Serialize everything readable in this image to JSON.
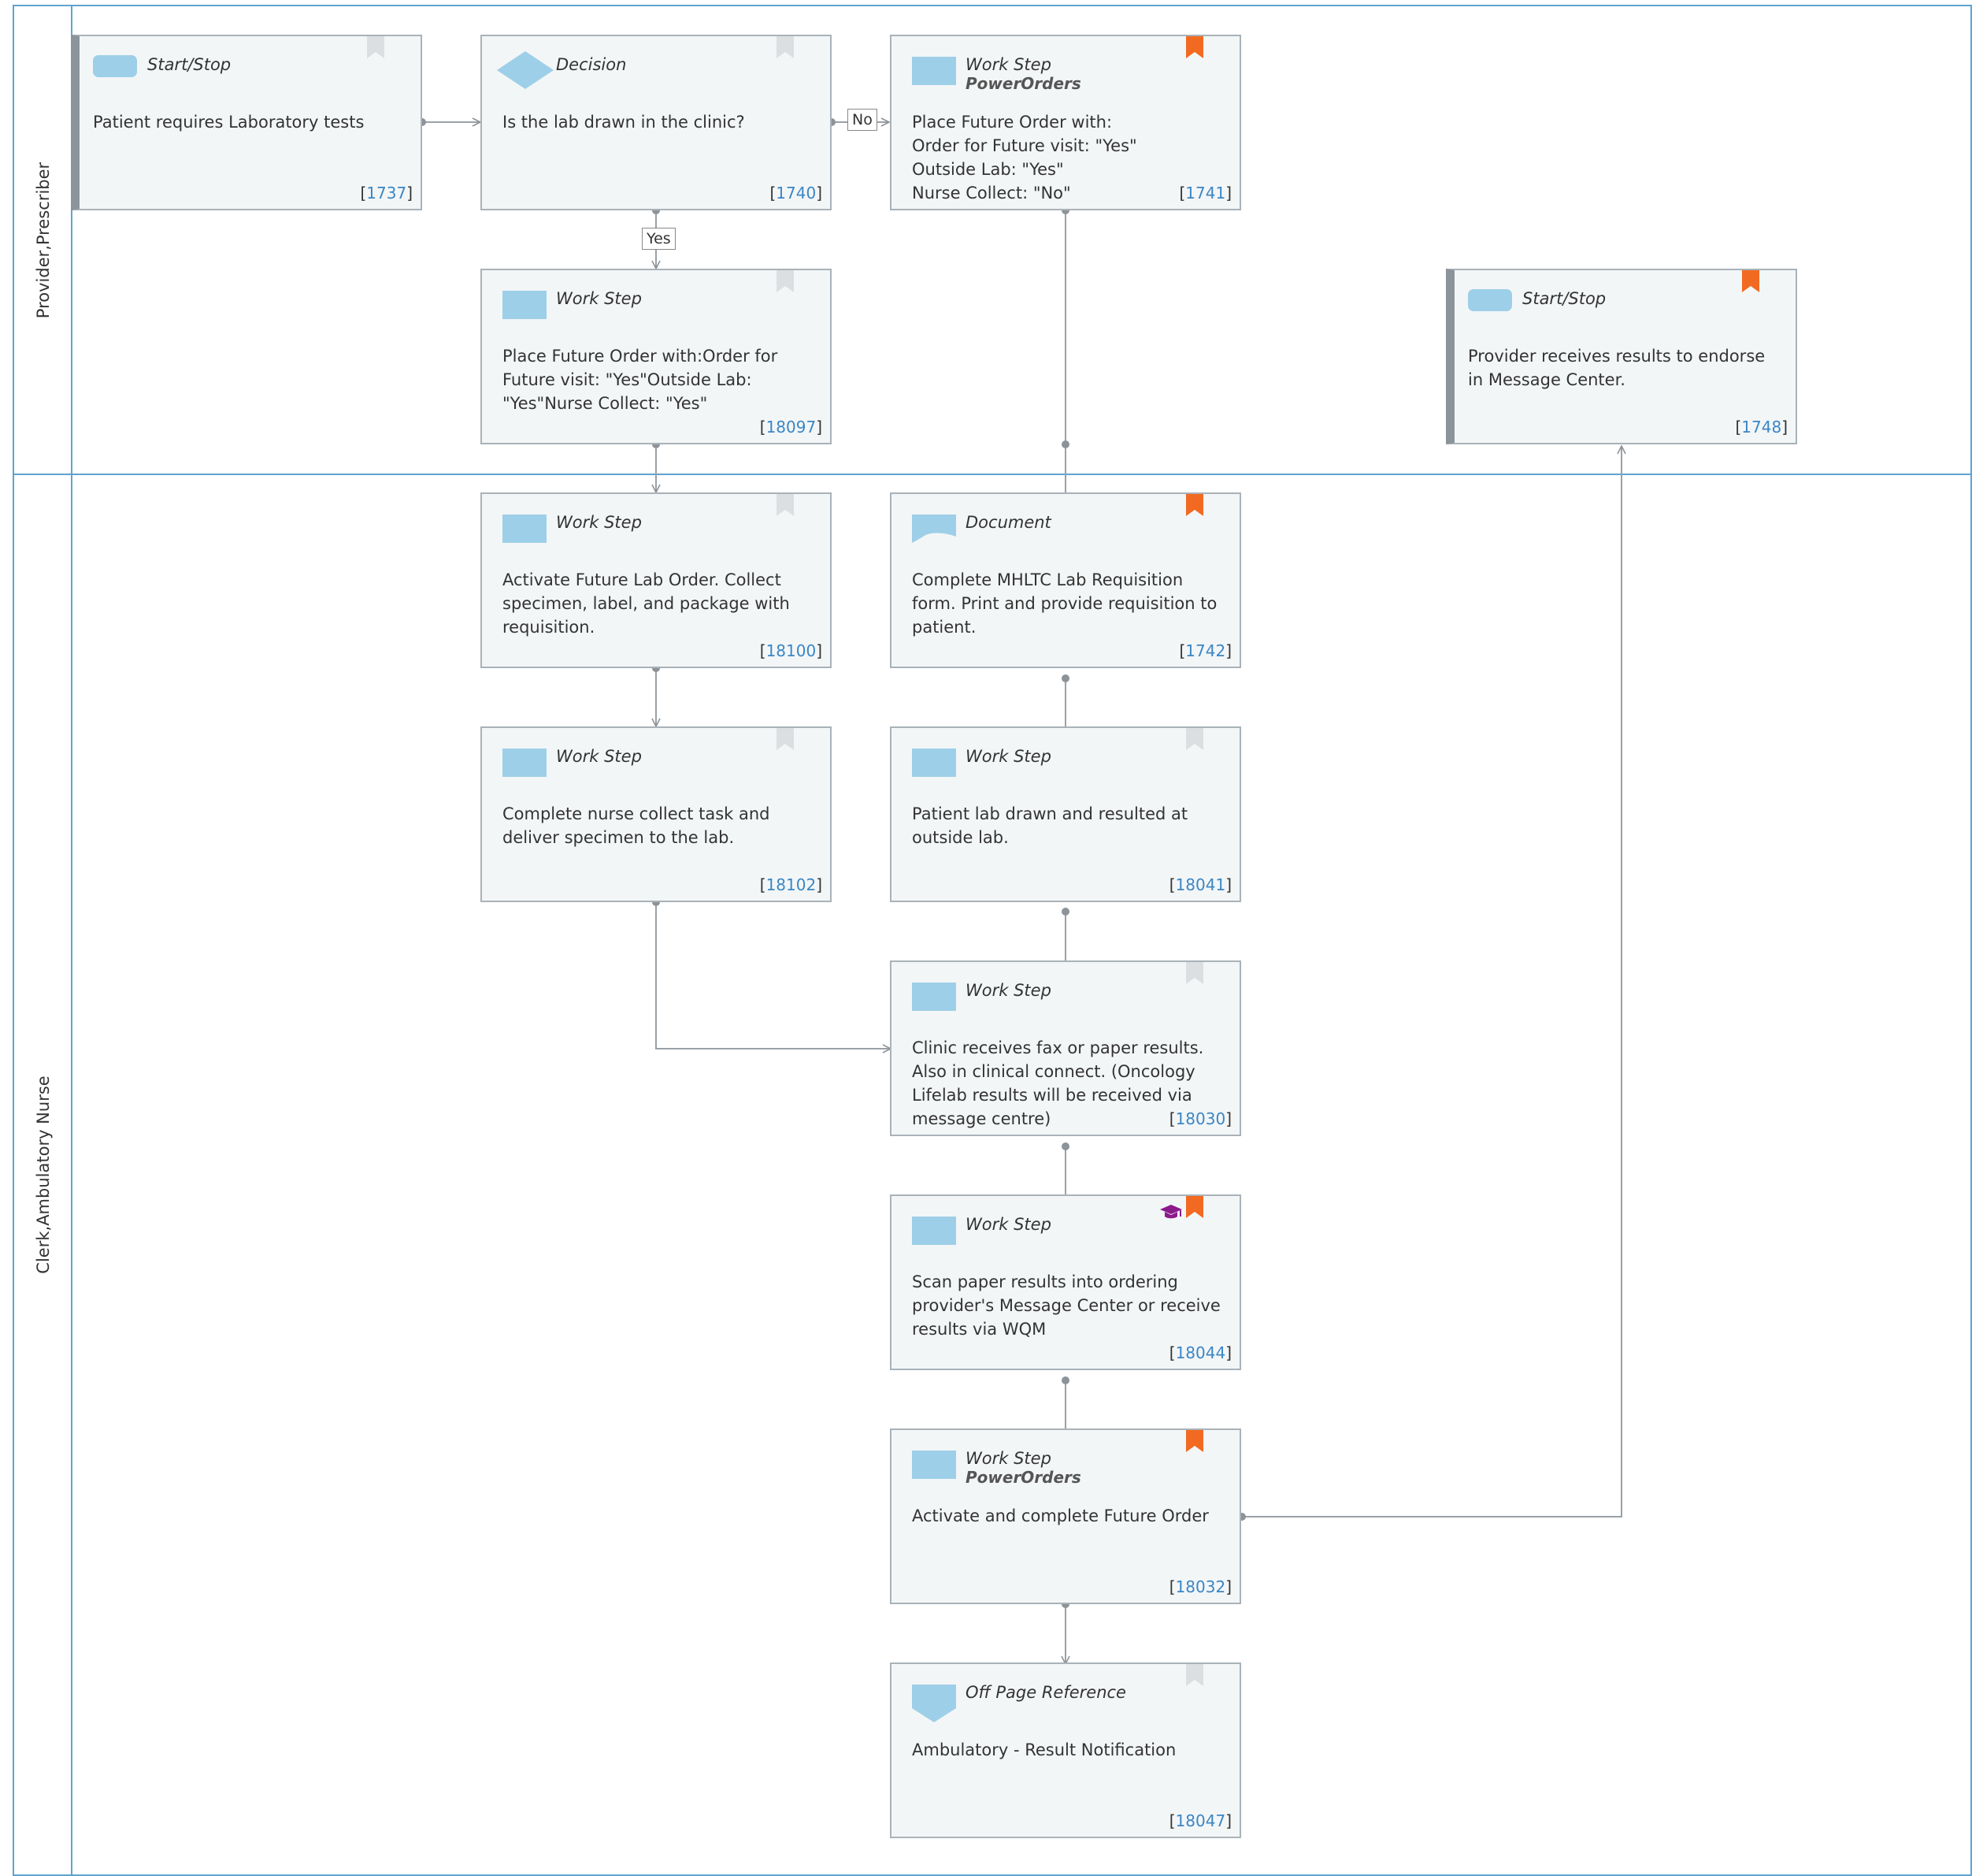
{
  "lanes": [
    {
      "name": "Provider,Prescriber"
    },
    {
      "name": "Clerk,Ambulatory Nurse"
    }
  ],
  "nodes": [
    {
      "key": "n1737",
      "type": "Start/Stop",
      "subtype": "",
      "body": "Patient requires Laboratory tests",
      "id": "1737",
      "bookmark": "grey"
    },
    {
      "key": "n1740",
      "type": "Decision",
      "subtype": "",
      "body": "Is the lab drawn in the clinic?",
      "id": "1740",
      "bookmark": "grey"
    },
    {
      "key": "n1741",
      "type": "Work Step",
      "subtype": "PowerOrders",
      "body": "Place Future Order with:\nOrder for Future visit: \"Yes\"\nOutside Lab: \"Yes\"\nNurse Collect: \"No\"",
      "id": "1741",
      "bookmark": "orange"
    },
    {
      "key": "n18097",
      "type": "Work Step",
      "subtype": "",
      "body": "Place Future Order with:Order for Future visit: \"Yes\"Outside Lab: \"Yes\"Nurse Collect: \"Yes\"",
      "id": "18097",
      "bookmark": "grey"
    },
    {
      "key": "n1748",
      "type": "Start/Stop",
      "subtype": "",
      "body": "Provider receives results to endorse in Message Center.",
      "id": "1748",
      "bookmark": "orange"
    },
    {
      "key": "n18100",
      "type": "Work Step",
      "subtype": "",
      "body": "Activate Future Lab Order. Collect specimen, label, and package with requisition.",
      "id": "18100",
      "bookmark": "grey"
    },
    {
      "key": "n1742",
      "type": "Document",
      "subtype": "",
      "body": "Complete MHLTC Lab Requisition form. Print and provide requisition to patient.",
      "id": "1742",
      "bookmark": "orange"
    },
    {
      "key": "n18102",
      "type": "Work Step",
      "subtype": "",
      "body": "Complete nurse collect task and deliver specimen to the lab.",
      "id": "18102",
      "bookmark": "grey"
    },
    {
      "key": "n18041",
      "type": "Work Step",
      "subtype": "",
      "body": "Patient lab drawn and resulted at outside lab.",
      "id": "18041",
      "bookmark": "grey"
    },
    {
      "key": "n18030",
      "type": "Work Step",
      "subtype": "",
      "body": "Clinic receives fax or paper results. Also in clinical connect. (Oncology Lifelab results will be received via message centre)",
      "id": "18030",
      "bookmark": "grey"
    },
    {
      "key": "n18044",
      "type": "Work Step",
      "subtype": "",
      "body": "Scan paper results into ordering provider's Message Center or receive results via WQM",
      "id": "18044",
      "bookmark": "orange"
    },
    {
      "key": "n18032",
      "type": "Work Step",
      "subtype": "PowerOrders",
      "body": "Activate and complete Future Order",
      "id": "18032",
      "bookmark": "orange"
    },
    {
      "key": "n18047",
      "type": "Off Page Reference",
      "subtype": "",
      "body": "Ambulatory - Result Notification",
      "id": "18047",
      "bookmark": "grey"
    }
  ],
  "edge_labels": {
    "no": "No",
    "yes": "Yes"
  },
  "colors": {
    "lane_border": "#5fa3d0",
    "node_fill": "#f3f6f7",
    "shape_fill": "#9ecfe8",
    "bookmark_orange": "#f26a21",
    "bookmark_grey": "#dcdfe1",
    "id_link": "#3b86c5",
    "education_icon": "#8b1a8b"
  },
  "icons": {
    "education": "graduation-cap-icon"
  }
}
